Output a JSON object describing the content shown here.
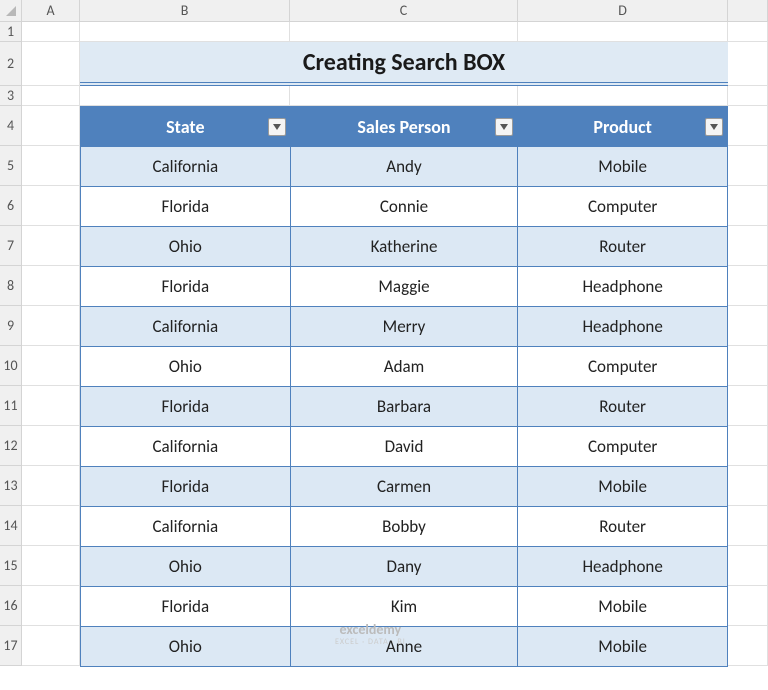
{
  "cols": [
    "A",
    "B",
    "C",
    "D"
  ],
  "rows": [
    "1",
    "2",
    "3",
    "4",
    "5",
    "6",
    "7",
    "8",
    "9",
    "10",
    "11",
    "12",
    "13",
    "14",
    "15",
    "16",
    "17"
  ],
  "title": "Creating Search BOX",
  "table": {
    "headers": [
      "State",
      "Sales Person",
      "Product"
    ],
    "data": [
      [
        "California",
        "Andy",
        "Mobile"
      ],
      [
        "Florida",
        "Connie",
        "Computer"
      ],
      [
        "Ohio",
        "Katherine",
        "Router"
      ],
      [
        "Florida",
        "Maggie",
        "Headphone"
      ],
      [
        "California",
        "Merry",
        "Headphone"
      ],
      [
        "Ohio",
        "Adam",
        "Computer"
      ],
      [
        "Florida",
        "Barbara",
        "Router"
      ],
      [
        "California",
        "David",
        "Computer"
      ],
      [
        "Florida",
        "Carmen",
        "Mobile"
      ],
      [
        "California",
        "Bobby",
        "Router"
      ],
      [
        "Ohio",
        "Dany",
        "Headphone"
      ],
      [
        "Florida",
        "Kim",
        "Mobile"
      ],
      [
        "Ohio",
        "Anne",
        "Mobile"
      ]
    ]
  },
  "watermark": {
    "main": "exceldemy",
    "sub": "EXCEL · DATA · BI"
  }
}
